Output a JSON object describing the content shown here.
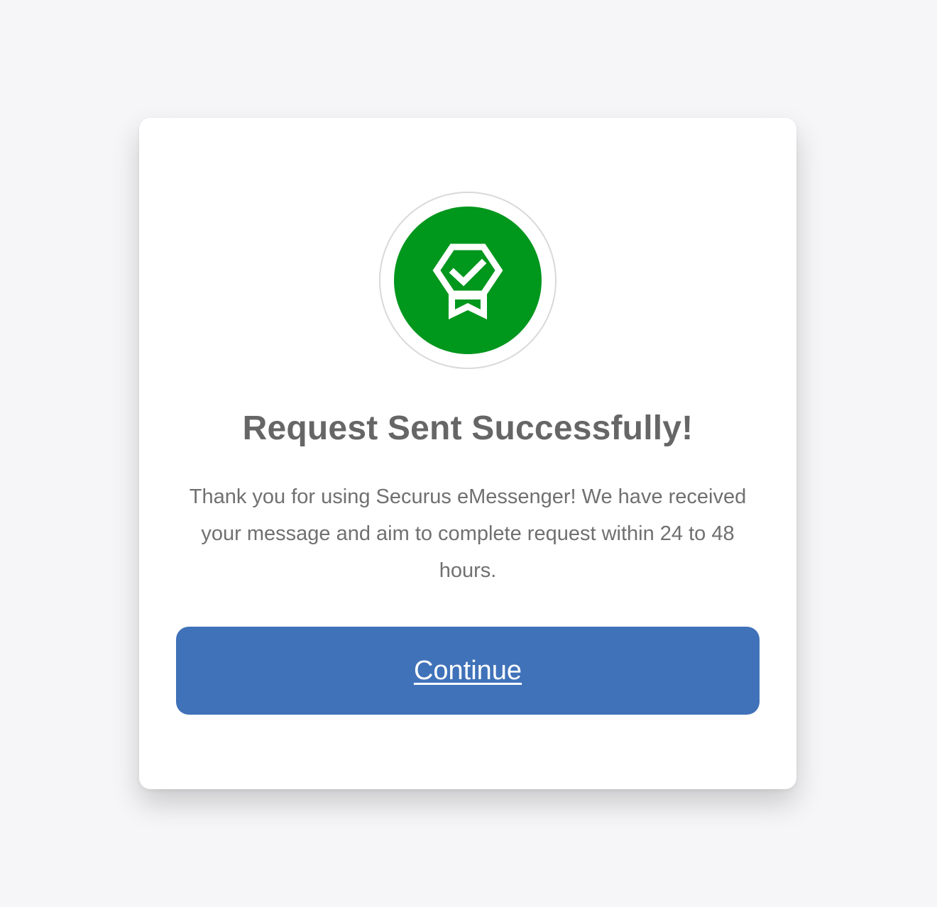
{
  "dialog": {
    "title": "Request Sent Successfully!",
    "message": "Thank you for using Securus eMessenger! We have received your message and aim to complete request within 24 to 48 hours.",
    "continue_label": "Continue",
    "icon": "award-badge-check-icon"
  },
  "colors": {
    "background": "#f6f6f8",
    "success_green": "#00971d",
    "button_blue": "#4072b9",
    "title_text": "#666666",
    "body_text": "#707070"
  }
}
